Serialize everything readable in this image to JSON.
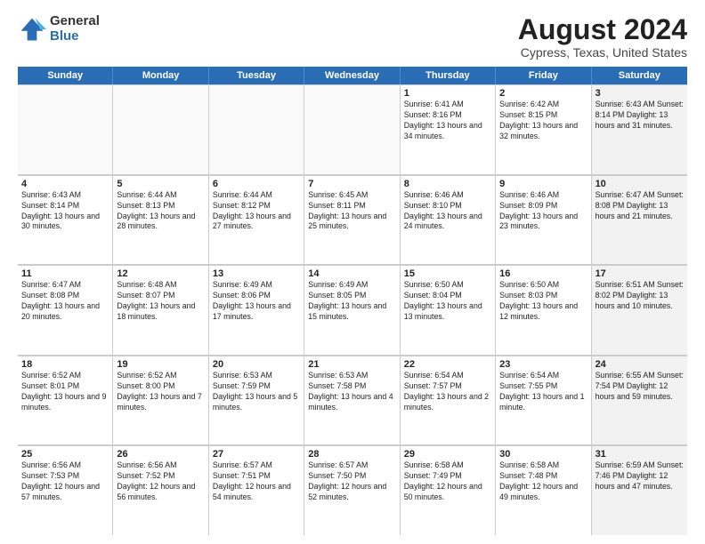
{
  "logo": {
    "line1": "General",
    "line2": "Blue"
  },
  "title": "August 2024",
  "subtitle": "Cypress, Texas, United States",
  "header_color": "#2a6db5",
  "days_of_week": [
    "Sunday",
    "Monday",
    "Tuesday",
    "Wednesday",
    "Thursday",
    "Friday",
    "Saturday"
  ],
  "weeks": [
    [
      {
        "num": "",
        "info": "",
        "empty": true
      },
      {
        "num": "",
        "info": "",
        "empty": true
      },
      {
        "num": "",
        "info": "",
        "empty": true
      },
      {
        "num": "",
        "info": "",
        "empty": true
      },
      {
        "num": "1",
        "info": "Sunrise: 6:41 AM\nSunset: 8:16 PM\nDaylight: 13 hours\nand 34 minutes."
      },
      {
        "num": "2",
        "info": "Sunrise: 6:42 AM\nSunset: 8:15 PM\nDaylight: 13 hours\nand 32 minutes."
      },
      {
        "num": "3",
        "info": "Sunrise: 6:43 AM\nSunset: 8:14 PM\nDaylight: 13 hours\nand 31 minutes.",
        "shaded": true
      }
    ],
    [
      {
        "num": "4",
        "info": "Sunrise: 6:43 AM\nSunset: 8:14 PM\nDaylight: 13 hours\nand 30 minutes."
      },
      {
        "num": "5",
        "info": "Sunrise: 6:44 AM\nSunset: 8:13 PM\nDaylight: 13 hours\nand 28 minutes."
      },
      {
        "num": "6",
        "info": "Sunrise: 6:44 AM\nSunset: 8:12 PM\nDaylight: 13 hours\nand 27 minutes."
      },
      {
        "num": "7",
        "info": "Sunrise: 6:45 AM\nSunset: 8:11 PM\nDaylight: 13 hours\nand 25 minutes."
      },
      {
        "num": "8",
        "info": "Sunrise: 6:46 AM\nSunset: 8:10 PM\nDaylight: 13 hours\nand 24 minutes."
      },
      {
        "num": "9",
        "info": "Sunrise: 6:46 AM\nSunset: 8:09 PM\nDaylight: 13 hours\nand 23 minutes."
      },
      {
        "num": "10",
        "info": "Sunrise: 6:47 AM\nSunset: 8:08 PM\nDaylight: 13 hours\nand 21 minutes.",
        "shaded": true
      }
    ],
    [
      {
        "num": "11",
        "info": "Sunrise: 6:47 AM\nSunset: 8:08 PM\nDaylight: 13 hours\nand 20 minutes."
      },
      {
        "num": "12",
        "info": "Sunrise: 6:48 AM\nSunset: 8:07 PM\nDaylight: 13 hours\nand 18 minutes."
      },
      {
        "num": "13",
        "info": "Sunrise: 6:49 AM\nSunset: 8:06 PM\nDaylight: 13 hours\nand 17 minutes."
      },
      {
        "num": "14",
        "info": "Sunrise: 6:49 AM\nSunset: 8:05 PM\nDaylight: 13 hours\nand 15 minutes."
      },
      {
        "num": "15",
        "info": "Sunrise: 6:50 AM\nSunset: 8:04 PM\nDaylight: 13 hours\nand 13 minutes."
      },
      {
        "num": "16",
        "info": "Sunrise: 6:50 AM\nSunset: 8:03 PM\nDaylight: 13 hours\nand 12 minutes."
      },
      {
        "num": "17",
        "info": "Sunrise: 6:51 AM\nSunset: 8:02 PM\nDaylight: 13 hours\nand 10 minutes.",
        "shaded": true
      }
    ],
    [
      {
        "num": "18",
        "info": "Sunrise: 6:52 AM\nSunset: 8:01 PM\nDaylight: 13 hours\nand 9 minutes."
      },
      {
        "num": "19",
        "info": "Sunrise: 6:52 AM\nSunset: 8:00 PM\nDaylight: 13 hours\nand 7 minutes."
      },
      {
        "num": "20",
        "info": "Sunrise: 6:53 AM\nSunset: 7:59 PM\nDaylight: 13 hours\nand 5 minutes."
      },
      {
        "num": "21",
        "info": "Sunrise: 6:53 AM\nSunset: 7:58 PM\nDaylight: 13 hours\nand 4 minutes."
      },
      {
        "num": "22",
        "info": "Sunrise: 6:54 AM\nSunset: 7:57 PM\nDaylight: 13 hours\nand 2 minutes."
      },
      {
        "num": "23",
        "info": "Sunrise: 6:54 AM\nSunset: 7:55 PM\nDaylight: 13 hours\nand 1 minute."
      },
      {
        "num": "24",
        "info": "Sunrise: 6:55 AM\nSunset: 7:54 PM\nDaylight: 12 hours\nand 59 minutes.",
        "shaded": true
      }
    ],
    [
      {
        "num": "25",
        "info": "Sunrise: 6:56 AM\nSunset: 7:53 PM\nDaylight: 12 hours\nand 57 minutes."
      },
      {
        "num": "26",
        "info": "Sunrise: 6:56 AM\nSunset: 7:52 PM\nDaylight: 12 hours\nand 56 minutes."
      },
      {
        "num": "27",
        "info": "Sunrise: 6:57 AM\nSunset: 7:51 PM\nDaylight: 12 hours\nand 54 minutes."
      },
      {
        "num": "28",
        "info": "Sunrise: 6:57 AM\nSunset: 7:50 PM\nDaylight: 12 hours\nand 52 minutes."
      },
      {
        "num": "29",
        "info": "Sunrise: 6:58 AM\nSunset: 7:49 PM\nDaylight: 12 hours\nand 50 minutes."
      },
      {
        "num": "30",
        "info": "Sunrise: 6:58 AM\nSunset: 7:48 PM\nDaylight: 12 hours\nand 49 minutes."
      },
      {
        "num": "31",
        "info": "Sunrise: 6:59 AM\nSunset: 7:46 PM\nDaylight: 12 hours\nand 47 minutes.",
        "shaded": true
      }
    ]
  ]
}
